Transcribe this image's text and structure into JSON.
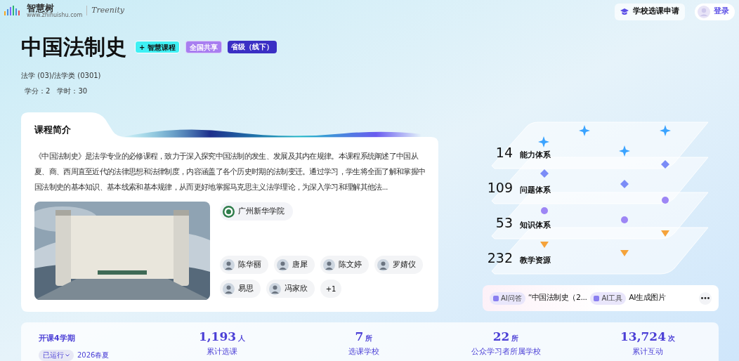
{
  "header": {
    "logo_text": "智慧树",
    "logo_url": "www.zhihuishu.com",
    "logo_subtext": "Treenity",
    "apply_button": "学校选课申请",
    "login_button": "登录"
  },
  "course": {
    "title": "中国法制史",
    "tags": [
      {
        "label": "+ 智慧课程",
        "kind": "smart"
      },
      {
        "label": "全国共享",
        "kind": "share"
      },
      {
        "label": "省级（线下）",
        "kind": "level"
      }
    ],
    "category": "法学 (03)/法学类 (0301)",
    "credits": "学分：2",
    "hours": "学时：30"
  },
  "intro": {
    "heading": "课程简介",
    "text": "《中国法制史》是法学专业的必修课程，致力于深入探究中国法制的发生、发展及其内在规律。本课程系统阐述了中国从夏、商、西周直至近代的法律思想和法律制度，内容涵盖了各个历史时期的法制变迁。通过学习，学生将全面了解和掌握中国法制史的基本知识、基本线索和基本规律，从而更好地掌握马克思主义法学理论，为深入学习和理解其他法...",
    "school": "广州新华学院",
    "teachers": [
      {
        "name": "陈华丽"
      },
      {
        "name": "唐犀"
      },
      {
        "name": "陈文婷"
      },
      {
        "name": "罗婧仪"
      },
      {
        "name": "易思"
      },
      {
        "name": "冯家欣"
      }
    ],
    "more": "+1"
  },
  "systems": [
    {
      "count": "14",
      "label": "能力体系"
    },
    {
      "count": "109",
      "label": "问题体系"
    },
    {
      "count": "53",
      "label": "知识体系"
    },
    {
      "count": "232",
      "label": "教学资源"
    }
  ],
  "ai_bar": {
    "items": [
      {
        "badge": "AI问答",
        "text": "“中国法制史（2..."
      },
      {
        "badge": "AI工具",
        "text": "AI生成图片"
      }
    ]
  },
  "stats": {
    "terms": "开课4学期",
    "status": "已运行",
    "semester": "2026春夏",
    "items": [
      {
        "value": "1,193",
        "unit": "人",
        "label": "累计选课"
      },
      {
        "value": "7",
        "unit": "所",
        "label": "选课学校"
      },
      {
        "value": "22",
        "unit": "所",
        "label": "公众学习者所属学校"
      },
      {
        "value": "13,724",
        "unit": "次",
        "label": "累计互动"
      }
    ]
  }
}
